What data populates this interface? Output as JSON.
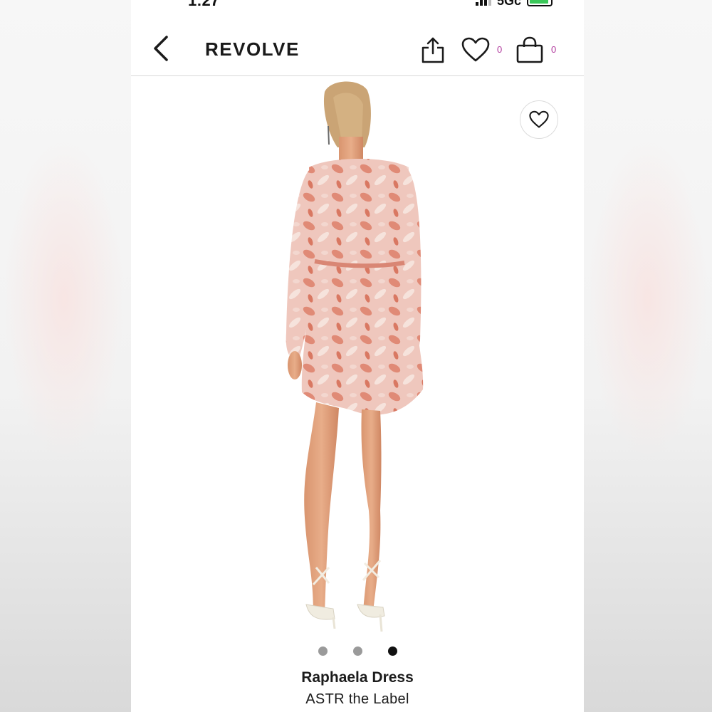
{
  "status_bar": {
    "time": "1:27",
    "network": "5Gc"
  },
  "header": {
    "brand": "REVOLVE",
    "back_icon": "chevron-left-icon",
    "share_icon": "share-icon",
    "wishlist_icon": "heart-icon",
    "wishlist_count": "0",
    "bag_icon": "shopping-bag-icon",
    "bag_count": "0",
    "accent_color": "#b0399c"
  },
  "gallery": {
    "favorite_icon": "heart-icon",
    "page_count": 3,
    "active_page": 3
  },
  "product": {
    "name": "Raphaela Dress",
    "brand": "ASTR the Label"
  }
}
